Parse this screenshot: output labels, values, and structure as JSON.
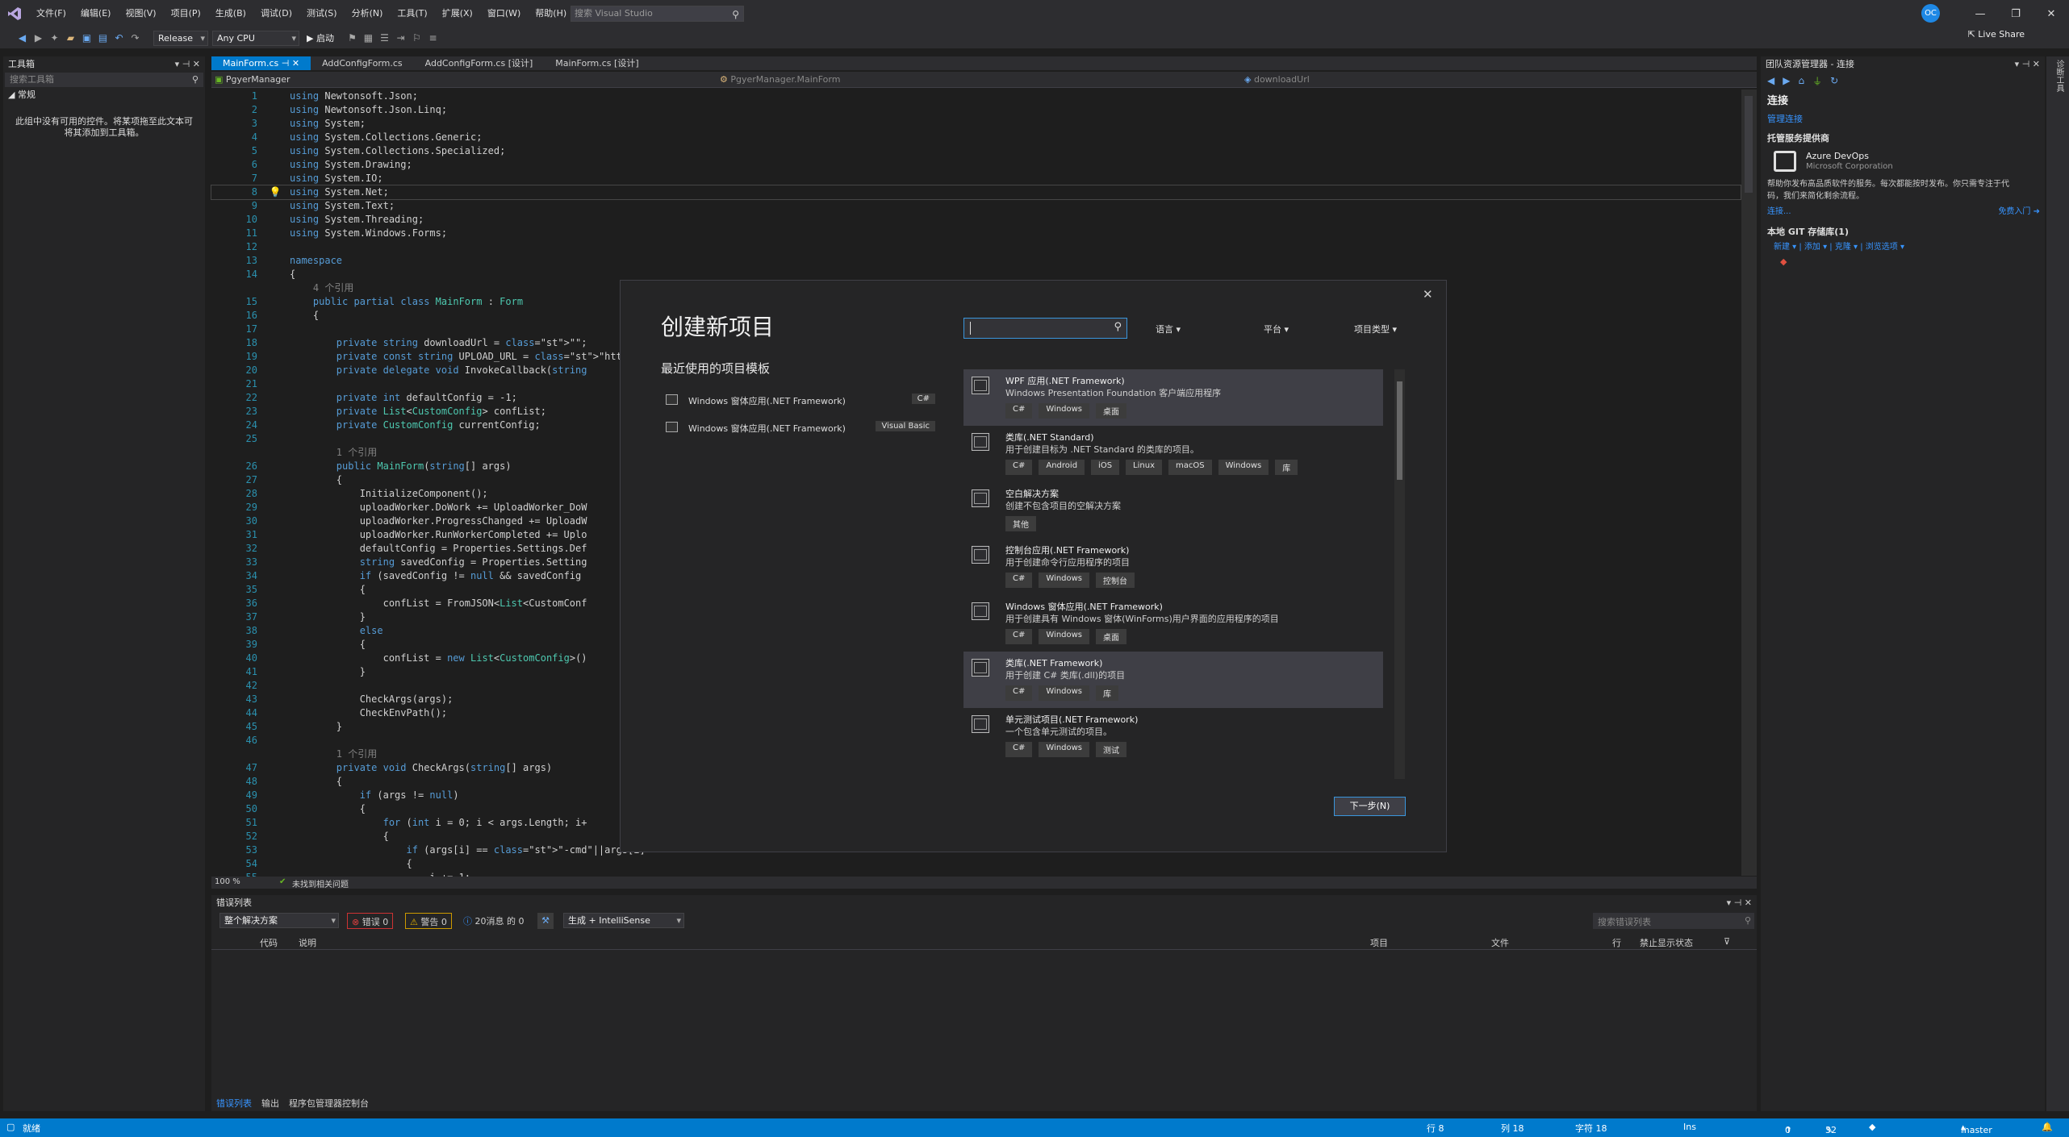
{
  "menu": {
    "items": [
      "文件(F)",
      "编辑(E)",
      "视图(V)",
      "项目(P)",
      "生成(B)",
      "调试(D)",
      "测试(S)",
      "分析(N)",
      "工具(T)",
      "扩展(X)",
      "窗口(W)",
      "帮助(H)"
    ],
    "search_placeholder": "搜索 Visual Studio",
    "avatar": "OC",
    "live_share": "Live Share"
  },
  "toolbar": {
    "config": "Release",
    "platform": "Any CPU",
    "start": "▶ 启动"
  },
  "toolbox": {
    "title": "工具箱",
    "search": "搜索工具箱",
    "section": "常规",
    "empty_msg": "此组中没有可用的控件。将某项拖至此文本可将其添加到工具箱。"
  },
  "tabs": [
    "MainForm.cs",
    "AddConfigForm.cs",
    "AddConfigForm.cs [设计]",
    "MainForm.cs [设计]"
  ],
  "nav": {
    "project": "PgyerManager",
    "class": "PgyerManager.MainForm",
    "member": "downloadUrl"
  },
  "code": [
    {
      "n": "1",
      "t": "using Newtonsoft.Json;"
    },
    {
      "n": "2",
      "t": "using Newtonsoft.Json.Linq;"
    },
    {
      "n": "3",
      "t": "using System;"
    },
    {
      "n": "4",
      "t": "using System.Collections.Generic;"
    },
    {
      "n": "5",
      "t": "using System.Collections.Specialized;"
    },
    {
      "n": "6",
      "t": "using System.Drawing;"
    },
    {
      "n": "7",
      "t": "using System.IO;"
    },
    {
      "n": "8",
      "t": "using System.Net;"
    },
    {
      "n": "9",
      "t": "using System.Text;"
    },
    {
      "n": "10",
      "t": "using System.Threading;"
    },
    {
      "n": "11",
      "t": "using System.Windows.Forms;"
    },
    {
      "n": "12",
      "t": ""
    },
    {
      "n": "13",
      "t": "namespace"
    },
    {
      "n": "14",
      "t": "{"
    },
    {
      "n": "",
      "t": "    4 个引用"
    },
    {
      "n": "15",
      "t": "    public partial class MainForm : Form"
    },
    {
      "n": "16",
      "t": "    {"
    },
    {
      "n": "17",
      "t": ""
    },
    {
      "n": "18",
      "t": "        private string downloadUrl = \"\";"
    },
    {
      "n": "19",
      "t": "        private const string UPLOAD_URL = \"http://w"
    },
    {
      "n": "20",
      "t": "        private delegate void InvokeCallback(string"
    },
    {
      "n": "21",
      "t": ""
    },
    {
      "n": "22",
      "t": "        private int defaultConfig = -1;"
    },
    {
      "n": "23",
      "t": "        private List<CustomConfig> confList;"
    },
    {
      "n": "24",
      "t": "        private CustomConfig currentConfig;"
    },
    {
      "n": "25",
      "t": ""
    },
    {
      "n": "",
      "t": "        1 个引用"
    },
    {
      "n": "26",
      "t": "        public MainForm(string[] args)"
    },
    {
      "n": "27",
      "t": "        {"
    },
    {
      "n": "28",
      "t": "            InitializeComponent();"
    },
    {
      "n": "29",
      "t": "            uploadWorker.DoWork += UploadWorker_DoW"
    },
    {
      "n": "30",
      "t": "            uploadWorker.ProgressChanged += UploadW"
    },
    {
      "n": "31",
      "t": "            uploadWorker.RunWorkerCompleted += Uplo"
    },
    {
      "n": "32",
      "t": "            defaultConfig = Properties.Settings.Def"
    },
    {
      "n": "33",
      "t": "            string savedConfig = Properties.Setting"
    },
    {
      "n": "34",
      "t": "            if (savedConfig != null && savedConfig"
    },
    {
      "n": "35",
      "t": "            {"
    },
    {
      "n": "36",
      "t": "                confList = FromJSON<List<CustomConf"
    },
    {
      "n": "37",
      "t": "            }"
    },
    {
      "n": "38",
      "t": "            else"
    },
    {
      "n": "39",
      "t": "            {"
    },
    {
      "n": "40",
      "t": "                confList = new List<CustomConfig>()"
    },
    {
      "n": "41",
      "t": "            }"
    },
    {
      "n": "42",
      "t": ""
    },
    {
      "n": "43",
      "t": "            CheckArgs(args);"
    },
    {
      "n": "44",
      "t": "            CheckEnvPath();"
    },
    {
      "n": "45",
      "t": "        }"
    },
    {
      "n": "46",
      "t": ""
    },
    {
      "n": "",
      "t": "        1 个引用"
    },
    {
      "n": "47",
      "t": "        private void CheckArgs(string[] args)"
    },
    {
      "n": "48",
      "t": "        {"
    },
    {
      "n": "49",
      "t": "            if (args != null)"
    },
    {
      "n": "50",
      "t": "            {"
    },
    {
      "n": "51",
      "t": "                for (int i = 0; i < args.Length; i+"
    },
    {
      "n": "52",
      "t": "                {"
    },
    {
      "n": "53",
      "t": "                    if (args[i] == \"-cmd\"||args[i]"
    },
    {
      "n": "54",
      "t": "                    {"
    },
    {
      "n": "55",
      "t": "                        i += 1;"
    }
  ],
  "editor_status": {
    "zoom": "100 %",
    "issues": "未找到相关问题"
  },
  "dialog": {
    "title": "创建新项目",
    "recent_title": "最近使用的项目模板",
    "recent": [
      {
        "label": "Windows 窗体应用(.NET Framework)",
        "lang": "C#"
      },
      {
        "label": "Windows 窗体应用(.NET Framework)",
        "lang": "Visual Basic"
      }
    ],
    "filters": {
      "lang": "语言",
      "platform": "平台",
      "type": "项目类型"
    },
    "templates": [
      {
        "name": "WPF 应用(.NET Framework)",
        "desc": "Windows Presentation Foundation 客户端应用程序",
        "tags": [
          "C#",
          "Windows",
          "桌面"
        ]
      },
      {
        "name": "类库(.NET Standard)",
        "desc": "用于创建目标为 .NET Standard 的类库的项目。",
        "tags": [
          "C#",
          "Android",
          "iOS",
          "Linux",
          "macOS",
          "Windows",
          "库"
        ]
      },
      {
        "name": "空白解决方案",
        "desc": "创建不包含项目的空解决方案",
        "tags": [
          "其他"
        ]
      },
      {
        "name": "控制台应用(.NET Framework)",
        "desc": "用于创建命令行应用程序的项目",
        "tags": [
          "C#",
          "Windows",
          "控制台"
        ]
      },
      {
        "name": "Windows 窗体应用(.NET Framework)",
        "desc": "用于创建具有 Windows 窗体(WinForms)用户界面的应用程序的项目",
        "tags": [
          "C#",
          "Windows",
          "桌面"
        ]
      },
      {
        "name": "类库(.NET Framework)",
        "desc": "用于创建 C# 类库(.dll)的项目",
        "tags": [
          "C#",
          "Windows",
          "库"
        ]
      },
      {
        "name": "单元测试项目(.NET Framework)",
        "desc": "一个包含单元测试的项目。",
        "tags": [
          "C#",
          "Windows",
          "测试"
        ]
      }
    ],
    "next": "下一步(N)"
  },
  "team": {
    "title": "团队资源管理器 - 连接",
    "connect": "连接",
    "manage": "管理连接",
    "hosted": "托管服务提供商",
    "azure": "Azure DevOps",
    "ms": "Microsoft Corporation",
    "desc": "帮助你发布高品质软件的服务。每次都能按时发布。你只需专注于代码，我们来简化剩余流程。",
    "connect_link": "连接...",
    "free": "免费入门",
    "git": "本地 GIT 存储库(1)",
    "git_actions": "新建 ▾ | 添加 ▾ | 克隆 ▾ | 浏览选项 ▾"
  },
  "side_strip": "诊断工具",
  "errors": {
    "title": "错误列表",
    "scope": "整个解决方案",
    "err": "错误 0",
    "warn": "警告 0",
    "msg": "20消息 的 0",
    "build": "生成 + IntelliSense",
    "search": "搜索错误列表",
    "cols": [
      "代码",
      "说明",
      "项目",
      "文件",
      "行",
      "禁止显示状态"
    ]
  },
  "bottom_tabs": [
    "错误列表",
    "输出",
    "程序包管理器控制台"
  ],
  "status": {
    "ready": "就绪",
    "line": "行 8",
    "col": "列 18",
    "ch": "字符 18",
    "ins": "Ins",
    "up": "0",
    "edits": "32",
    "branch": "master"
  }
}
